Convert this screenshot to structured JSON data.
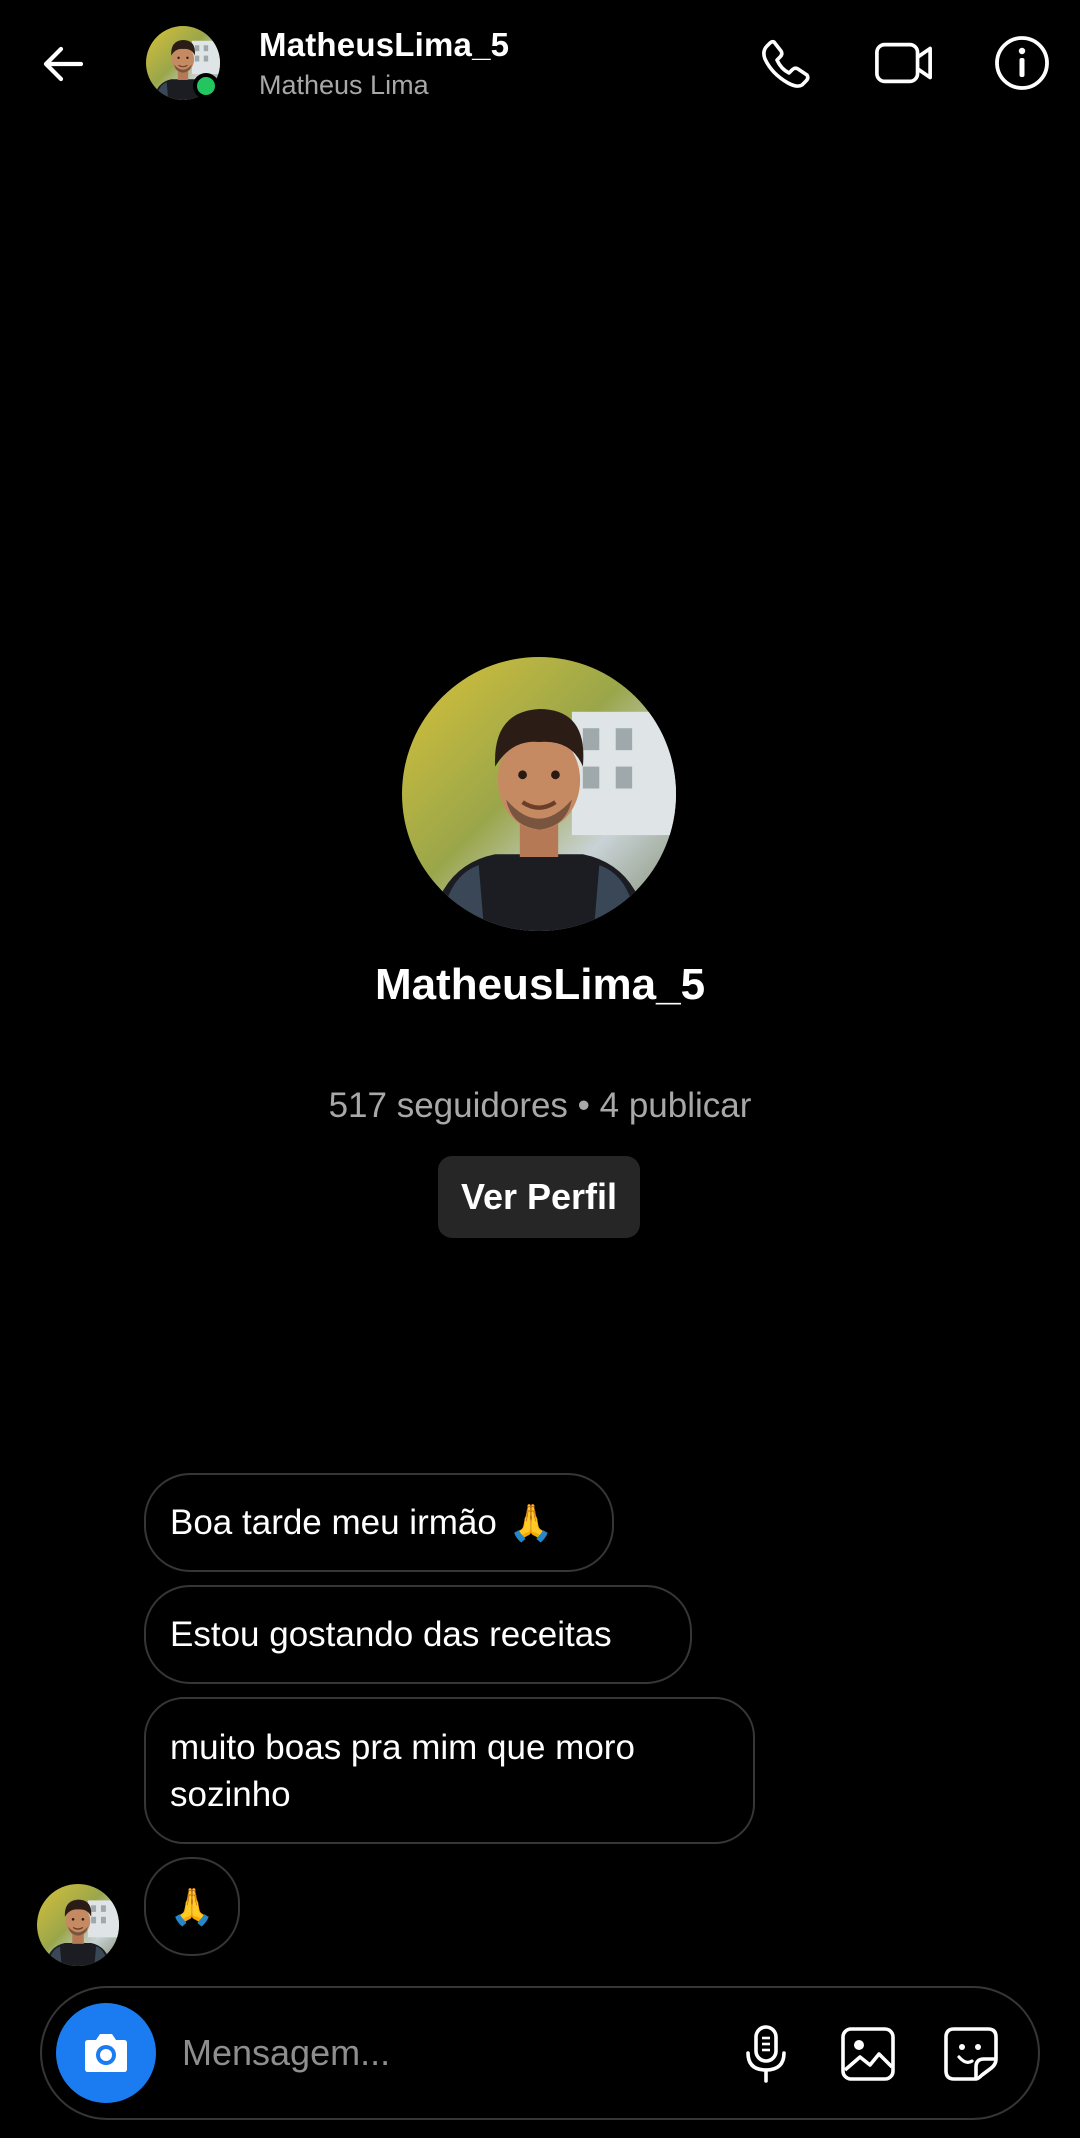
{
  "header": {
    "username": "MatheusLima_5",
    "fullname": "Matheus Lima",
    "online_color": "#22c55e",
    "icons": [
      "back-arrow-icon",
      "phone-icon",
      "video-camera-icon",
      "info-icon"
    ]
  },
  "profile": {
    "username": "MatheusLima_5",
    "stats": "517 seguidores • 4 publicar",
    "view_profile_label": "Ver Perfil"
  },
  "messages": [
    {
      "text": "Boa tarde meu irmão",
      "emoji": "🙏"
    },
    {
      "text": "Estou gostando das receitas",
      "emoji": ""
    },
    {
      "text": "muito boas pra mim que moro sozinho",
      "emoji": ""
    },
    {
      "text": "",
      "emoji": "🙏"
    }
  ],
  "composer": {
    "placeholder": "Mensagem...",
    "accent_color": "#1a7cf0",
    "icons": [
      "camera-icon",
      "microphone-icon",
      "gallery-icon",
      "sticker-icon"
    ]
  }
}
